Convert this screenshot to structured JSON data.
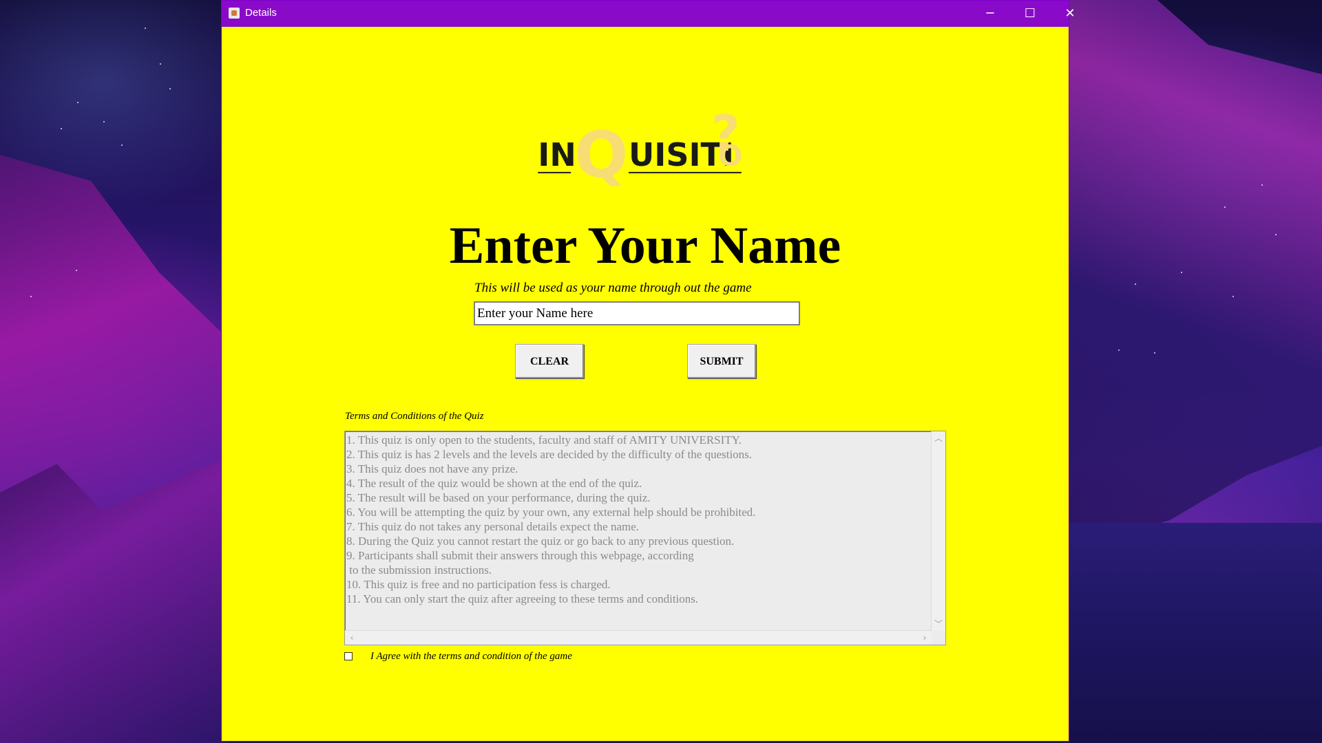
{
  "window": {
    "title": "Details",
    "controls": {
      "minimize": "─",
      "maximize": "☐",
      "close": "✕"
    }
  },
  "logo": {
    "part1": "IN",
    "big_letter": "Q",
    "part2": "UISITI",
    "end_letter": "O",
    "question_mark": "?"
  },
  "form": {
    "heading": "Enter Your Name",
    "subheading": "This will be used as your name through out the game",
    "name_input_value": "Enter your Name here",
    "clear_label": "CLEAR",
    "submit_label": "SUBMIT"
  },
  "terms": {
    "label": "Terms and Conditions of the Quiz",
    "text": "1. This quiz is only open to the students, faculty and staff of AMITY UNIVERSITY.\n2. This quiz is has 2 levels and the levels are decided by the difficulty of the questions.\n3. This quiz does not have any prize.\n4. The result of the quiz would be shown at the end of the quiz.\n5. The result will be based on your performance, during the quiz.\n6. You will be attempting the quiz by your own, any external help should be prohibited.\n7. This quiz do not takes any personal details expect the name.\n8. During the Quiz you cannot restart the quiz or go back to any previous question.\n9. Participants shall submit their answers through this webpage, according\n to the submission instructions.\n10. This quiz is free and no participation fess is charged.\n11. You can only start the quiz after agreeing to these terms and conditions.",
    "agree_label": "I Agree with the terms and condition of the game",
    "agree_checked": false
  },
  "colors": {
    "window_background": "#ffff00",
    "titlebar": "#8a0ac9",
    "logo_text": "#1a1a1a",
    "logo_accent": "#f7dd73"
  }
}
